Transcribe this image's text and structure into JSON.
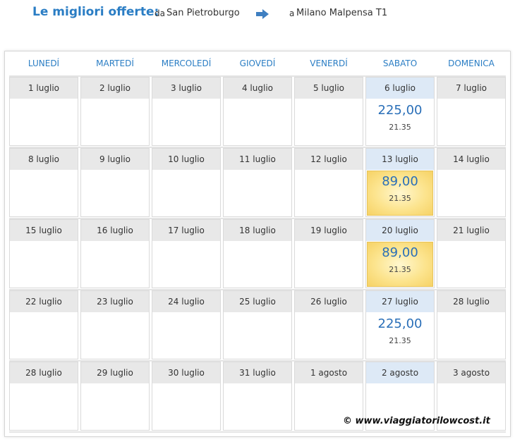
{
  "header": {
    "title": "Le migliori offerte:",
    "from_prefix": "da",
    "from_city": "San Pietroburgo",
    "to_prefix": "a",
    "to_city": "Milano Malpensa T1",
    "arrow_icon": "right-arrow-icon",
    "accent_color": "#2a7dc4"
  },
  "weekdays": [
    "LUNEDÍ",
    "MARTEDÍ",
    "MERCOLEDÍ",
    "GIOVEDÍ",
    "VENERDÍ",
    "SABATO",
    "DOMENICA"
  ],
  "weeks": [
    [
      "1 luglio",
      "2 luglio",
      "3 luglio",
      "4 luglio",
      "5 luglio",
      "6 luglio",
      "7 luglio"
    ],
    [
      "8 luglio",
      "9 luglio",
      "10 luglio",
      "11 luglio",
      "12 luglio",
      "13 luglio",
      "14 luglio"
    ],
    [
      "15 luglio",
      "16 luglio",
      "17 luglio",
      "18 luglio",
      "19 luglio",
      "20 luglio",
      "21 luglio"
    ],
    [
      "22 luglio",
      "23 luglio",
      "24 luglio",
      "25 luglio",
      "26 luglio",
      "27 luglio",
      "28 luglio"
    ],
    [
      "28 luglio",
      "29 luglio",
      "30 luglio",
      "31 luglio",
      "1 agosto",
      "2 agosto",
      "3 agosto"
    ]
  ],
  "offers": [
    {
      "week": 0,
      "day": 5,
      "price": "225,00",
      "time": "21.35",
      "best": false
    },
    {
      "week": 1,
      "day": 5,
      "price": "89,00",
      "time": "21.35",
      "best": true
    },
    {
      "week": 2,
      "day": 5,
      "price": "89,00",
      "time": "21.35",
      "best": true
    },
    {
      "week": 3,
      "day": 5,
      "price": "225,00",
      "time": "21.35",
      "best": false
    }
  ],
  "watermark": "© www.viaggiatorilowcost.it"
}
